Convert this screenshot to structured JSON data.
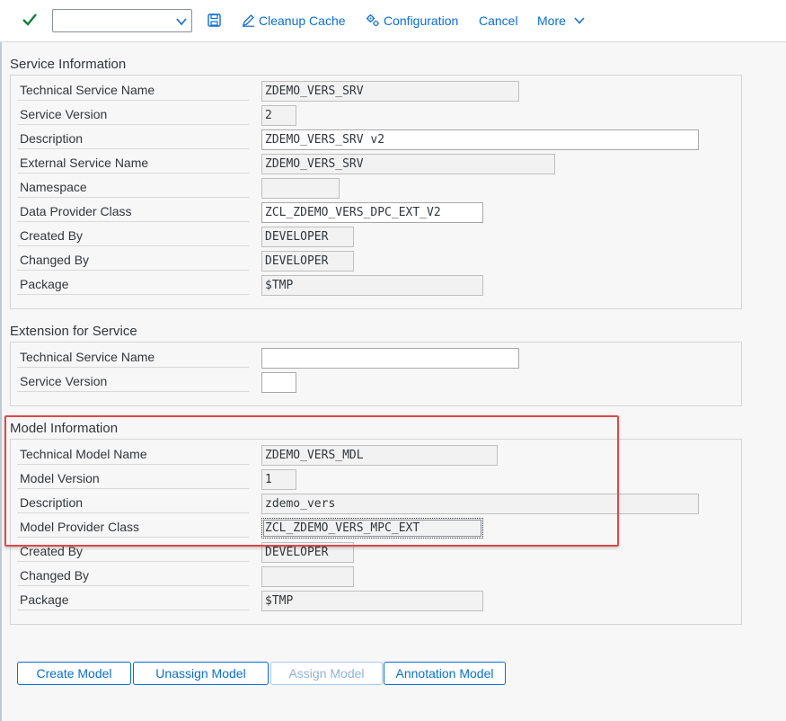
{
  "toolbar": {
    "combo_value": "",
    "cleanup_cache": "Cleanup Cache",
    "configuration": "Configuration",
    "cancel": "Cancel",
    "more": "More"
  },
  "service_info": {
    "title": "Service Information",
    "rows": [
      {
        "label": "Technical Service Name",
        "value": "ZDEMO_VERS_SRV"
      },
      {
        "label": "Service Version",
        "value": "2"
      },
      {
        "label": "Description",
        "value": "ZDEMO_VERS_SRV v2"
      },
      {
        "label": "External Service Name",
        "value": "ZDEMO_VERS_SRV"
      },
      {
        "label": "Namespace",
        "value": ""
      },
      {
        "label": "Data Provider Class",
        "value": "ZCL_ZDEMO_VERS_DPC_EXT_V2"
      },
      {
        "label": "Created By",
        "value": "DEVELOPER"
      },
      {
        "label": "Changed By",
        "value": "DEVELOPER"
      },
      {
        "label": "Package",
        "value": "$TMP"
      }
    ]
  },
  "extension": {
    "title": "Extension for Service",
    "rows": [
      {
        "label": "Technical Service Name",
        "value": ""
      },
      {
        "label": "Service Version",
        "value": ""
      }
    ]
  },
  "model_info": {
    "title": "Model Information",
    "rows": [
      {
        "label": "Technical Model Name",
        "value": "ZDEMO_VERS_MDL"
      },
      {
        "label": "Model Version",
        "value": "1"
      },
      {
        "label": "Description",
        "value": "zdemo_vers"
      },
      {
        "label": "Model Provider Class",
        "value": "ZCL_ZDEMO_VERS_MPC_EXT"
      },
      {
        "label": "Created By",
        "value": "DEVELOPER"
      },
      {
        "label": "Changed By",
        "value": ""
      },
      {
        "label": "Package",
        "value": "$TMP"
      }
    ]
  },
  "buttons": {
    "create_model": "Create Model",
    "unassign_model": "Unassign Model",
    "assign_model": "Assign Model",
    "annotation_model": "Annotation Model"
  },
  "colors": {
    "accent": "#0a6ed1",
    "check": "#107e3e",
    "highlight": "#e04848"
  }
}
